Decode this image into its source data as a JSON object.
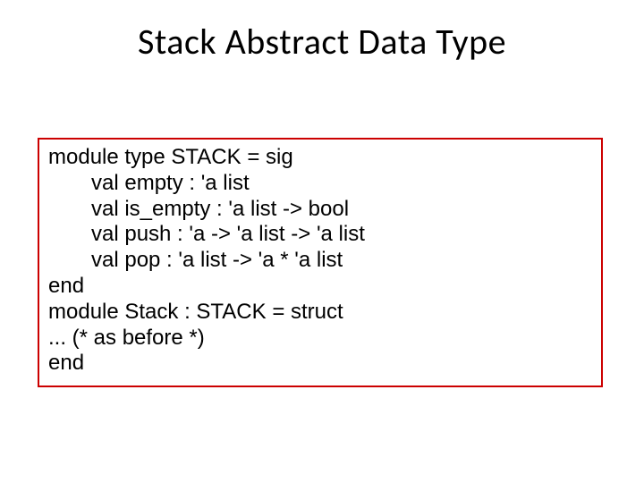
{
  "title": "Stack Abstract Data Type",
  "code": {
    "l1": "module type STACK = sig",
    "l2": "val empty : 'a list",
    "l3": "val is_empty : 'a list -> bool",
    "l4": "val push : 'a -> 'a list -> 'a list",
    "l5": "val pop : 'a list -> 'a * 'a list",
    "l6": "end",
    "l7": "module Stack : STACK = struct",
    "l8": "... (* as before *)",
    "l9": "end"
  }
}
